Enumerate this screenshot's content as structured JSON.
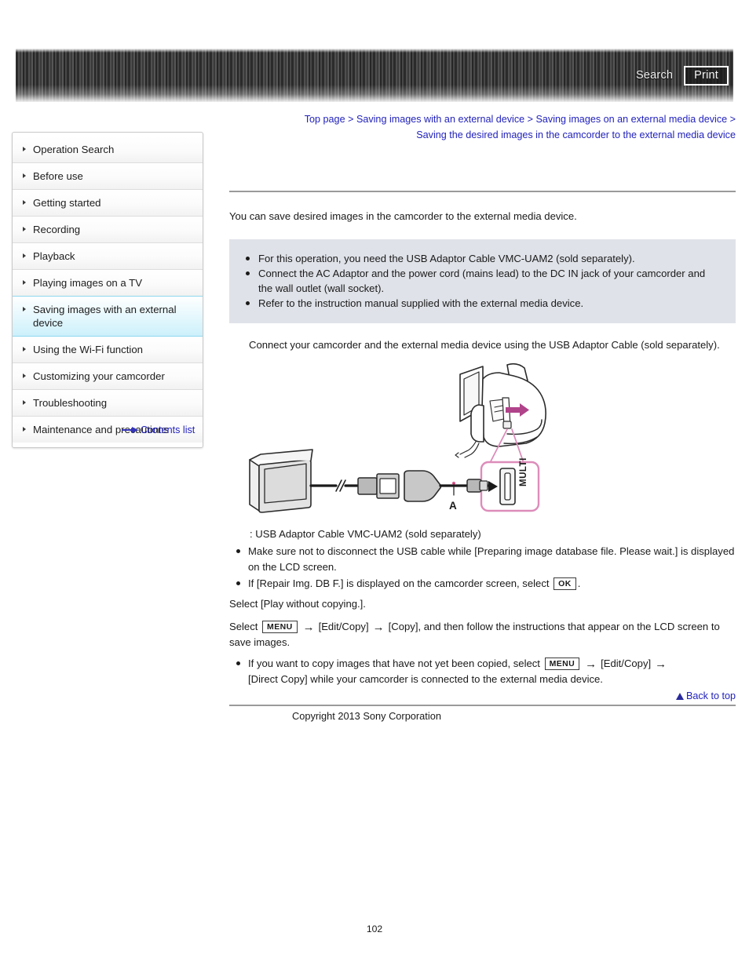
{
  "header": {
    "search_label": "Search",
    "print_label": "Print"
  },
  "breadcrumb": {
    "items": [
      "Top page",
      "Saving images with an external device",
      "Saving images on an external media device",
      "Saving the desired images in the camcorder to the external media device"
    ],
    "separator": ">"
  },
  "sidebar": {
    "items": [
      {
        "label": "Operation Search",
        "active": false
      },
      {
        "label": "Before use",
        "active": false
      },
      {
        "label": "Getting started",
        "active": false
      },
      {
        "label": "Recording",
        "active": false
      },
      {
        "label": "Playback",
        "active": false
      },
      {
        "label": "Playing images on a TV",
        "active": false
      },
      {
        "label": "Saving images with an external device",
        "active": true
      },
      {
        "label": "Using the Wi-Fi function",
        "active": false
      },
      {
        "label": "Customizing your camcorder",
        "active": false
      },
      {
        "label": "Troubleshooting",
        "active": false
      },
      {
        "label": "Maintenance and precautions",
        "active": false
      }
    ],
    "contents_list_label": "Contents list"
  },
  "main": {
    "intro": "You can save desired images in the camcorder to the external media device.",
    "notes": [
      "For this operation, you need the USB Adaptor Cable VMC-UAM2 (sold separately).",
      "Connect the AC Adaptor and the power cord (mains lead) to the DC IN jack of your camcorder and the wall outlet (wall socket).",
      "Refer to the instruction manual supplied with the external media device."
    ],
    "step1": "Connect your camcorder and the external media device using the USB Adaptor Cable (sold separately).",
    "figure": {
      "callout_label": "MULTI",
      "cable_label": "A"
    },
    "legend": ": USB Adaptor Cable VMC-UAM2 (sold separately)",
    "bullet1": "Make sure not to disconnect the USB cable while [Preparing image database file. Please wait.] is displayed on the LCD screen.",
    "bullet2_pre": "If [Repair Img. DB F.] is displayed on the camcorder screen, select",
    "bullet2_key": "OK",
    "bullet2_post": ".",
    "step2": "Select [Play without copying.].",
    "step3_pre": "Select",
    "step3_key": "MENU",
    "step3_mid": "[Edit/Copy]",
    "step3_mid2": "[Copy], and then follow the instructions that appear on the LCD screen to save images.",
    "bullet3_pre": "If you want to copy images that have not yet been copied, select",
    "bullet3_key": "MENU",
    "bullet3_mid": "[Edit/Copy]",
    "bullet3_post": "[Direct Copy] while your camcorder is connected to the external media device.",
    "arrow_glyph": "→"
  },
  "footer": {
    "back_to_top_label": "Back to top",
    "copyright": "Copyright 2013 Sony Corporation",
    "page_number": "102"
  },
  "colors": {
    "link": "#2222bb",
    "note_bg": "#dfe2e8",
    "active_nav": "#cdf0fb",
    "callout_pink": "#e08fb8"
  }
}
